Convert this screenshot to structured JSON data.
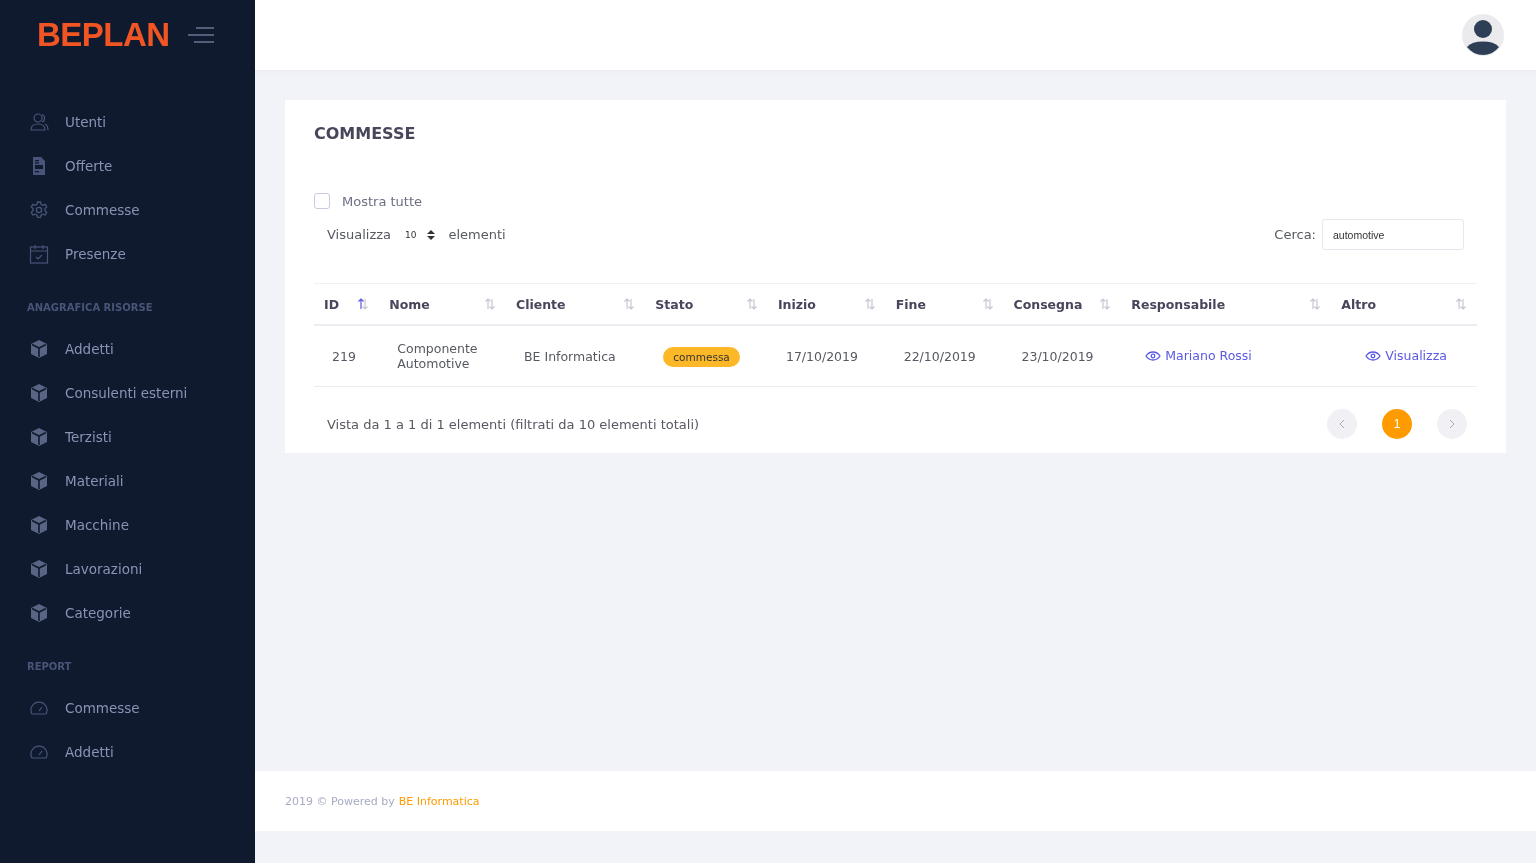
{
  "logo": "BEPLAN",
  "sidebar": {
    "sections": [
      {
        "items": [
          {
            "label": "Utenti",
            "kind": "user"
          },
          {
            "label": "Offerte",
            "kind": "document"
          },
          {
            "label": "Commesse",
            "kind": "gear"
          },
          {
            "label": "Presenze",
            "kind": "calendar"
          }
        ]
      },
      {
        "title": "ANAGRAFICA RISORSE",
        "items": [
          {
            "label": "Addetti",
            "kind": "cube"
          },
          {
            "label": "Consulenti esterni",
            "kind": "cube"
          },
          {
            "label": "Terzisti",
            "kind": "cube"
          },
          {
            "label": "Materiali",
            "kind": "cube"
          },
          {
            "label": "Macchine",
            "kind": "cube"
          },
          {
            "label": "Lavorazioni",
            "kind": "cube"
          },
          {
            "label": "Categorie",
            "kind": "cube"
          }
        ]
      },
      {
        "title": "REPORT",
        "items": [
          {
            "label": "Commesse",
            "kind": "gauge"
          },
          {
            "label": "Addetti",
            "kind": "gauge"
          }
        ]
      }
    ]
  },
  "card": {
    "title": "COMMESSE",
    "show_all": {
      "label": "Mostra tutte",
      "checked": false
    },
    "length": {
      "before": "Visualizza",
      "value": "10",
      "after": "elementi"
    },
    "search": {
      "label": "Cerca:",
      "value": "automotive"
    },
    "table": {
      "columns": [
        {
          "label": "ID",
          "sorted": true
        },
        {
          "label": "Nome",
          "sorted": false
        },
        {
          "label": "Cliente",
          "sorted": false
        },
        {
          "label": "Stato",
          "sorted": false
        },
        {
          "label": "Inizio",
          "sorted": false
        },
        {
          "label": "Fine",
          "sorted": false
        },
        {
          "label": "Consegna",
          "sorted": false
        },
        {
          "label": "Responsabile",
          "sorted": false
        },
        {
          "label": "Altro",
          "sorted": false
        }
      ],
      "rows": [
        {
          "id": "219",
          "nome": [
            "Componente",
            "Automotive"
          ],
          "cliente": "BE Informatica",
          "stato": "commessa",
          "inizio": "17/10/2019",
          "fine": "22/10/2019",
          "consegna": "23/10/2019",
          "responsabile": "Mariano Rossi",
          "altro": "Visualizza"
        }
      ]
    },
    "info": "Vista da 1 a 1 di 1 elementi (filtrati da 10 elementi totali)",
    "pages": [
      {
        "label": "1",
        "selected": true
      }
    ]
  },
  "footer": {
    "text": "2019 © Powered by",
    "link": "BE Informatica"
  }
}
